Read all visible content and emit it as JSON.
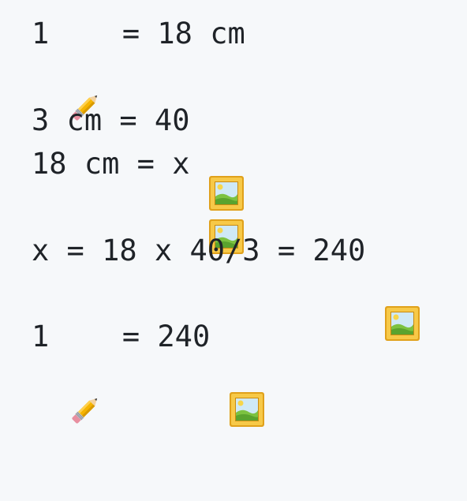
{
  "lines": [
    {
      "before": "1 ",
      "icon": "pencil-icon",
      "after": " = 18 cm"
    },
    {
      "before": "3 cm = 40 ",
      "icon": "framed-picture-icon",
      "after": ""
    },
    {
      "before": "18 cm = x ",
      "icon": "framed-picture-icon",
      "after": ""
    },
    {
      "before": "x = 18 x 40/3 = 240 ",
      "icon": "framed-picture-icon",
      "after": ""
    },
    {
      "before": "1 ",
      "icon": "pencil-icon",
      "after": " = 240 "
    },
    {
      "before": "",
      "icon": "framed-picture-icon",
      "after": ""
    }
  ],
  "colors": {
    "background": "#f6f8fa",
    "text": "#1f2328"
  }
}
